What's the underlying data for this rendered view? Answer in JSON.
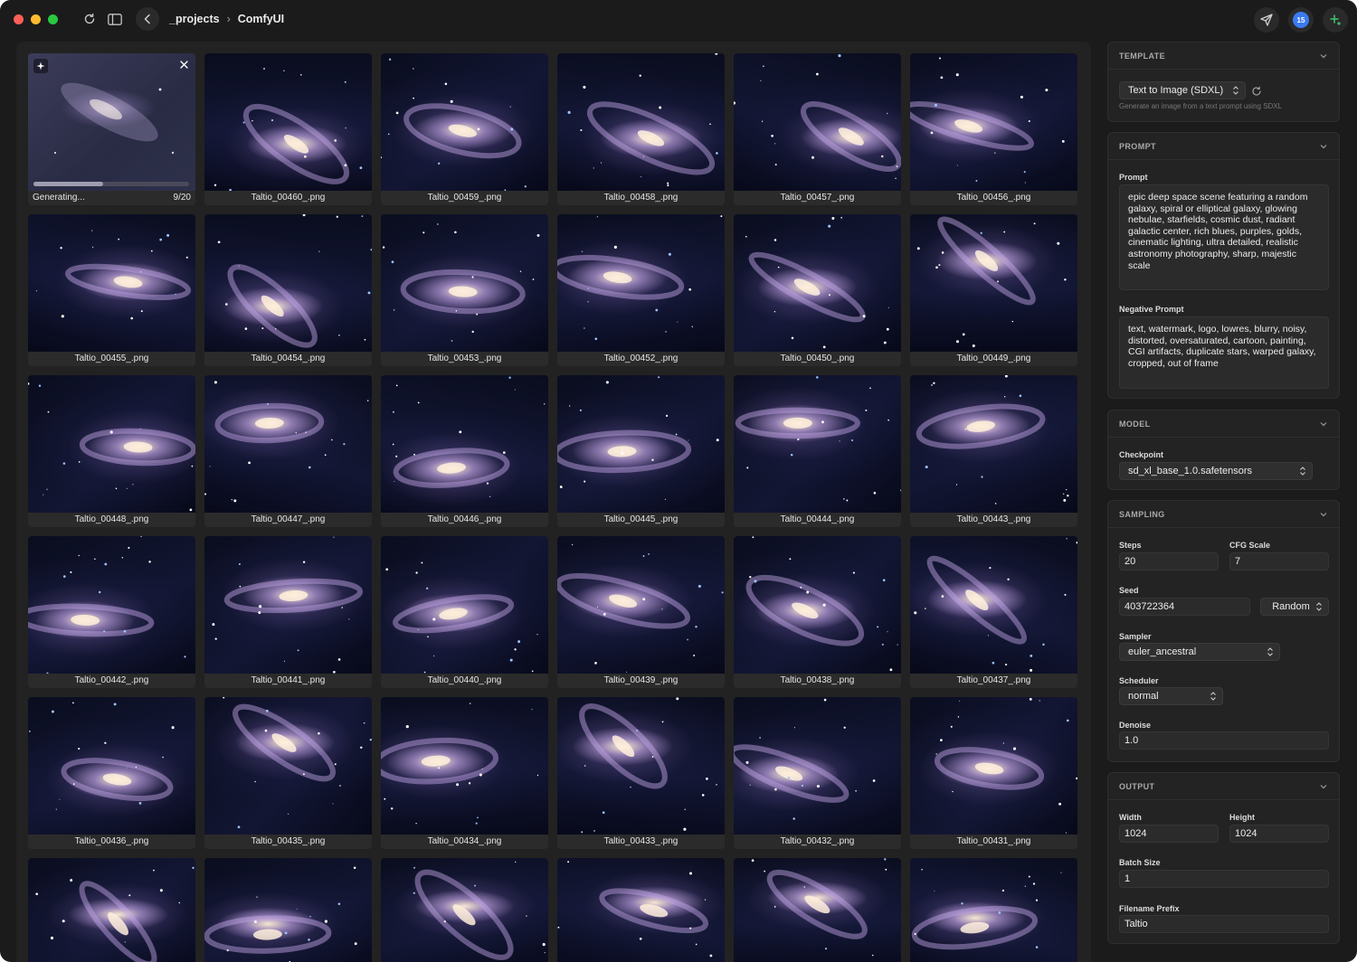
{
  "breadcrumb": {
    "parent": "_projects",
    "separator": "›",
    "current": "ComfyUI"
  },
  "titlebar": {
    "notification_count": "15"
  },
  "generating": {
    "label": "Generating...",
    "step_text": "9/20",
    "progress_fraction": 0.45
  },
  "gallery": {
    "tiles": [
      "Taltio_00460_.png",
      "Taltio_00459_.png",
      "Taltio_00458_.png",
      "Taltio_00457_.png",
      "Taltio_00456_.png",
      "Taltio_00455_.png",
      "Taltio_00454_.png",
      "Taltio_00453_.png",
      "Taltio_00452_.png",
      "Taltio_00450_.png",
      "Taltio_00449_.png",
      "Taltio_00448_.png",
      "Taltio_00447_.png",
      "Taltio_00446_.png",
      "Taltio_00445_.png",
      "Taltio_00444_.png",
      "Taltio_00443_.png",
      "Taltio_00442_.png",
      "Taltio_00441_.png",
      "Taltio_00440_.png",
      "Taltio_00439_.png",
      "Taltio_00438_.png",
      "Taltio_00437_.png",
      "Taltio_00436_.png",
      "Taltio_00435_.png",
      "Taltio_00434_.png",
      "Taltio_00433_.png",
      "Taltio_00432_.png",
      "Taltio_00431_.png",
      "",
      "",
      "",
      "",
      "",
      ""
    ]
  },
  "template": {
    "header": "TEMPLATE",
    "selected": "Text to Image (SDXL)",
    "description": "Generate an image from a text prompt using SDXL"
  },
  "prompt": {
    "header": "PROMPT",
    "prompt_label": "Prompt",
    "prompt_value": "epic deep space scene featuring a random galaxy, spiral or elliptical galaxy, glowing nebulae, starfields, cosmic dust, radiant galactic center, rich blues, purples, golds, cinematic lighting, ultra detailed, realistic astronomy photography, sharp, majestic scale",
    "negative_label": "Negative Prompt",
    "negative_value": "text, watermark, logo, lowres, blurry, noisy, distorted, oversaturated, cartoon, painting, CGI artifacts, duplicate stars, warped galaxy, cropped, out of frame"
  },
  "model": {
    "header": "MODEL",
    "checkpoint_label": "Checkpoint",
    "checkpoint_value": "sd_xl_base_1.0.safetensors"
  },
  "sampling": {
    "header": "SAMPLING",
    "steps_label": "Steps",
    "steps_value": "20",
    "cfg_label": "CFG Scale",
    "cfg_value": "7",
    "seed_label": "Seed",
    "seed_value": "403722364",
    "seed_mode": "Random",
    "sampler_label": "Sampler",
    "sampler_value": "euler_ancestral",
    "scheduler_label": "Scheduler",
    "scheduler_value": "normal",
    "denoise_label": "Denoise",
    "denoise_value": "1.0"
  },
  "output": {
    "header": "OUTPUT",
    "width_label": "Width",
    "width_value": "1024",
    "height_label": "Height",
    "height_value": "1024",
    "batch_label": "Batch Size",
    "batch_value": "1",
    "prefix_label": "Filename Prefix",
    "prefix_value": "Taltio"
  }
}
